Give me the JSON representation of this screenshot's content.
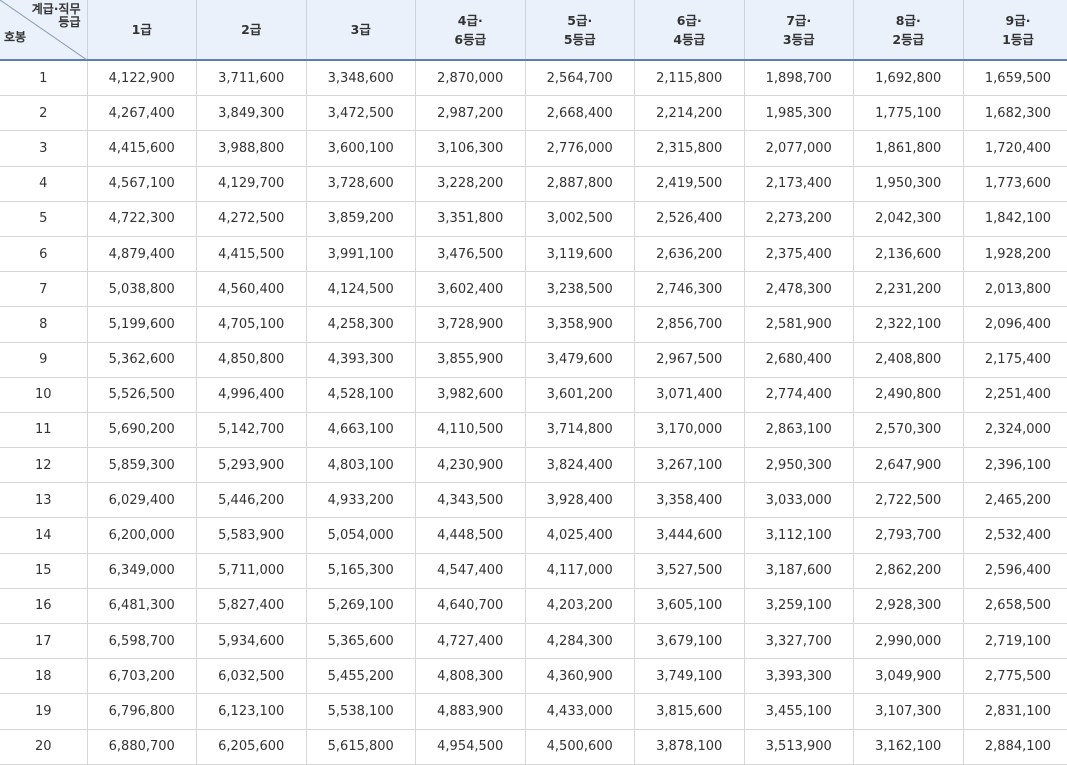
{
  "header": {
    "corner_top_1": "계급·직무",
    "corner_top_2": "등급",
    "corner_bottom": "호봉",
    "columns": [
      [
        "1급"
      ],
      [
        "2급"
      ],
      [
        "3급"
      ],
      [
        "4급·",
        "6등급"
      ],
      [
        "5급·",
        "5등급"
      ],
      [
        "6급·",
        "4등급"
      ],
      [
        "7급·",
        "3등급"
      ],
      [
        "8급·",
        "2등급"
      ],
      [
        "9급·",
        "1등급"
      ]
    ]
  },
  "rows": [
    [
      "1",
      "4,122,900",
      "3,711,600",
      "3,348,600",
      "2,870,000",
      "2,564,700",
      "2,115,800",
      "1,898,700",
      "1,692,800",
      "1,659,500"
    ],
    [
      "2",
      "4,267,400",
      "3,849,300",
      "3,472,500",
      "2,987,200",
      "2,668,400",
      "2,214,200",
      "1,985,300",
      "1,775,100",
      "1,682,300"
    ],
    [
      "3",
      "4,415,600",
      "3,988,800",
      "3,600,100",
      "3,106,300",
      "2,776,000",
      "2,315,800",
      "2,077,000",
      "1,861,800",
      "1,720,400"
    ],
    [
      "4",
      "4,567,100",
      "4,129,700",
      "3,728,600",
      "3,228,200",
      "2,887,800",
      "2,419,500",
      "2,173,400",
      "1,950,300",
      "1,773,600"
    ],
    [
      "5",
      "4,722,300",
      "4,272,500",
      "3,859,200",
      "3,351,800",
      "3,002,500",
      "2,526,400",
      "2,273,200",
      "2,042,300",
      "1,842,100"
    ],
    [
      "6",
      "4,879,400",
      "4,415,500",
      "3,991,100",
      "3,476,500",
      "3,119,600",
      "2,636,200",
      "2,375,400",
      "2,136,600",
      "1,928,200"
    ],
    [
      "7",
      "5,038,800",
      "4,560,400",
      "4,124,500",
      "3,602,400",
      "3,238,500",
      "2,746,300",
      "2,478,300",
      "2,231,200",
      "2,013,800"
    ],
    [
      "8",
      "5,199,600",
      "4,705,100",
      "4,258,300",
      "3,728,900",
      "3,358,900",
      "2,856,700",
      "2,581,900",
      "2,322,100",
      "2,096,400"
    ],
    [
      "9",
      "5,362,600",
      "4,850,800",
      "4,393,300",
      "3,855,900",
      "3,479,600",
      "2,967,500",
      "2,680,400",
      "2,408,800",
      "2,175,400"
    ],
    [
      "10",
      "5,526,500",
      "4,996,400",
      "4,528,100",
      "3,982,600",
      "3,601,200",
      "3,071,400",
      "2,774,400",
      "2,490,800",
      "2,251,400"
    ],
    [
      "11",
      "5,690,200",
      "5,142,700",
      "4,663,100",
      "4,110,500",
      "3,714,800",
      "3,170,000",
      "2,863,100",
      "2,570,300",
      "2,324,000"
    ],
    [
      "12",
      "5,859,300",
      "5,293,900",
      "4,803,100",
      "4,230,900",
      "3,824,400",
      "3,267,100",
      "2,950,300",
      "2,647,900",
      "2,396,100"
    ],
    [
      "13",
      "6,029,400",
      "5,446,200",
      "4,933,200",
      "4,343,500",
      "3,928,400",
      "3,358,400",
      "3,033,000",
      "2,722,500",
      "2,465,200"
    ],
    [
      "14",
      "6,200,000",
      "5,583,900",
      "5,054,000",
      "4,448,500",
      "4,025,400",
      "3,444,600",
      "3,112,100",
      "2,793,700",
      "2,532,400"
    ],
    [
      "15",
      "6,349,000",
      "5,711,000",
      "5,165,300",
      "4,547,400",
      "4,117,000",
      "3,527,500",
      "3,187,600",
      "2,862,200",
      "2,596,400"
    ],
    [
      "16",
      "6,481,300",
      "5,827,400",
      "5,269,100",
      "4,640,700",
      "4,203,200",
      "3,605,100",
      "3,259,100",
      "2,928,300",
      "2,658,500"
    ],
    [
      "17",
      "6,598,700",
      "5,934,600",
      "5,365,600",
      "4,727,400",
      "4,284,300",
      "3,679,100",
      "3,327,700",
      "2,990,000",
      "2,719,100"
    ],
    [
      "18",
      "6,703,200",
      "6,032,500",
      "5,455,200",
      "4,808,300",
      "4,360,900",
      "3,749,100",
      "3,393,300",
      "3,049,900",
      "2,775,500"
    ],
    [
      "19",
      "6,796,800",
      "6,123,100",
      "5,538,100",
      "4,883,900",
      "4,433,000",
      "3,815,600",
      "3,455,100",
      "3,107,300",
      "2,831,100"
    ],
    [
      "20",
      "6,880,700",
      "6,205,600",
      "5,615,800",
      "4,954,500",
      "4,500,600",
      "3,878,100",
      "3,513,900",
      "3,162,100",
      "2,884,100"
    ]
  ]
}
